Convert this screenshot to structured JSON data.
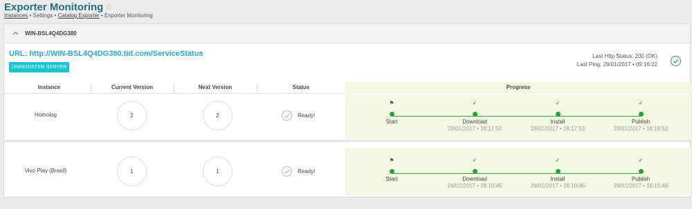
{
  "header": {
    "title": "Exporter Monitoring",
    "star_icon": "star-icon",
    "breadcrumb": {
      "link1": "Instances",
      "sep1": " • ",
      "item2": "Settings",
      "sep2": " • ",
      "link3": "Catalog Exporter",
      "sep3": " • ",
      "item4": "Exporter Monitoring"
    }
  },
  "server": {
    "name": "WIN-BSL4Q4DG380",
    "url": "URL: http://WIN-BSL4Q4DG380.tid.com/ServiceStatus",
    "unregister_label": "UNREGISTER SERVER",
    "http_status": "Last Http Status: 200 (OK)",
    "last_ping": "Last Ping: 29/01/2017 • 09:16:22"
  },
  "table": {
    "headers": {
      "instance": "Instance",
      "current_version": "Current Version",
      "next_version": "Next Version",
      "status": "Status",
      "progress": "Progress"
    },
    "rows": [
      {
        "instance": "Homolog",
        "current_version": "2",
        "next_version": "2",
        "status": "Ready!",
        "stages": [
          {
            "label": "Start",
            "time": "",
            "icon": "⚑"
          },
          {
            "label": "Download",
            "time": "28/01/2017 • 18:17:50",
            "icon": "✓"
          },
          {
            "label": "Install",
            "time": "28/01/2017 • 18:17:53",
            "icon": "✓"
          },
          {
            "label": "Publish",
            "time": "28/01/2017 • 18:18:53",
            "icon": "✓"
          }
        ]
      },
      {
        "instance": "Vivo Play (Brasil)",
        "current_version": "1",
        "next_version": "1",
        "status": "Ready!",
        "stages": [
          {
            "label": "Start",
            "time": "",
            "icon": "⚑"
          },
          {
            "label": "Download",
            "time": "28/01/2017 • 18:10:45",
            "icon": "✓"
          },
          {
            "label": "Install",
            "time": "28/01/2017 • 18:10:46",
            "icon": "✓"
          },
          {
            "label": "Publish",
            "time": "28/01/2017 • 18:15:48",
            "icon": "✓"
          }
        ]
      }
    ]
  },
  "colors": {
    "title": "#1e6f7c",
    "accent": "#2aa8c4",
    "button": "#19c4d2",
    "success": "#22a33e",
    "progress_bg": "#f5f8e3"
  }
}
